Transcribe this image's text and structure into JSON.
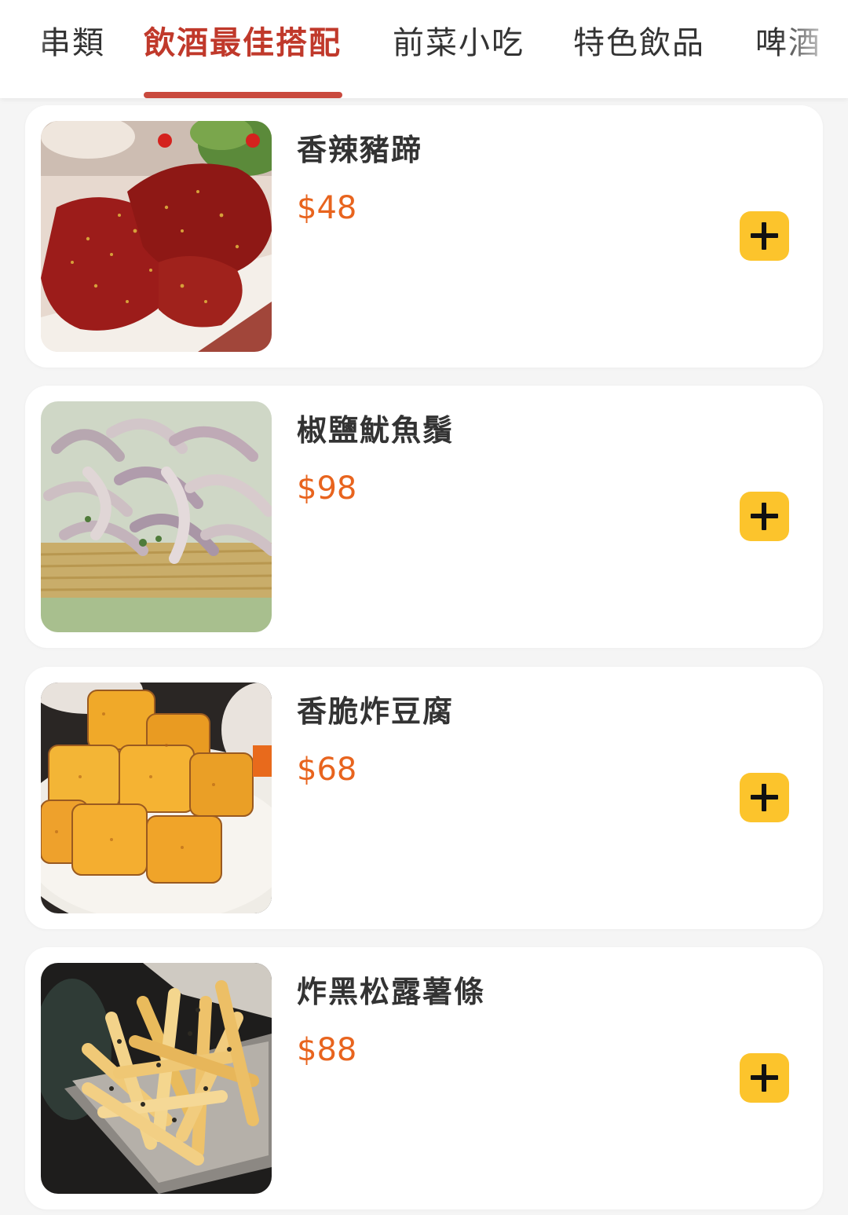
{
  "tabs": [
    {
      "label": "串類"
    },
    {
      "label": "飲酒最佳搭配",
      "active": true
    },
    {
      "label": "前菜小吃"
    },
    {
      "label": "特色飲品"
    },
    {
      "label": "啤酒"
    }
  ],
  "colors": {
    "active_tab": "#c0392b",
    "underline": "#c94a3e",
    "price": "#e8641e",
    "add_button": "#fcc42c",
    "background": "#f5f5f5"
  },
  "items": [
    {
      "name": "香辣豬蹄",
      "currency": "$",
      "price": "48",
      "image": "spicy-pig-trotter-photo",
      "add_icon": "plus-icon"
    },
    {
      "name": "椒鹽魷魚鬚",
      "currency": "$",
      "price": "98",
      "image": "salt-pepper-squid-photo",
      "add_icon": "plus-icon"
    },
    {
      "name": "香脆炸豆腐",
      "currency": "$",
      "price": "68",
      "image": "fried-tofu-photo",
      "add_icon": "plus-icon"
    },
    {
      "name": "炸黑松露薯條",
      "currency": "$",
      "price": "88",
      "image": "truffle-fries-photo",
      "add_icon": "plus-icon"
    }
  ]
}
